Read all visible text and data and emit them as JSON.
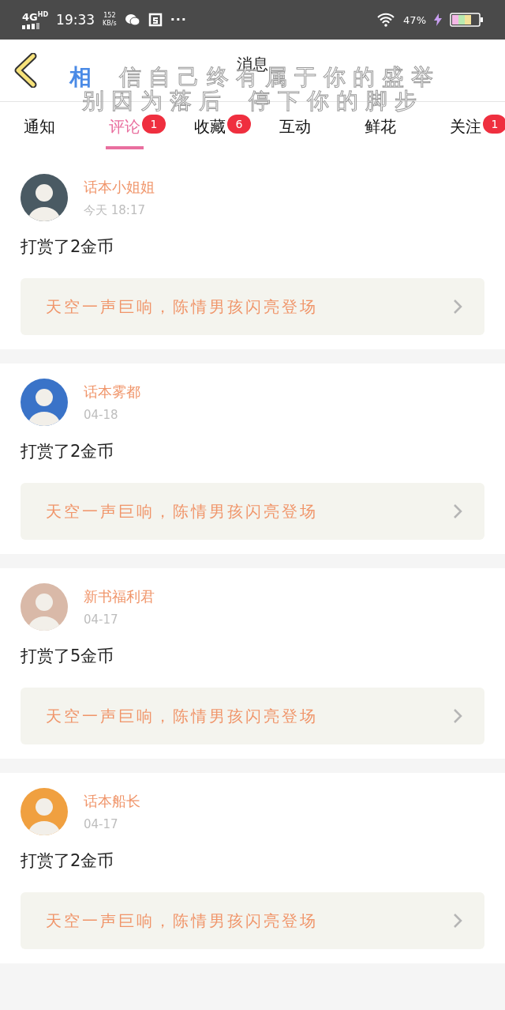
{
  "status_bar": {
    "network": "4G",
    "network_badge": "HD",
    "time": "19:33",
    "speed": "152",
    "speed_unit": "KB/s",
    "more": "···",
    "battery": "47%"
  },
  "header": {
    "title": "消息"
  },
  "tabs": [
    {
      "label": "通知",
      "selected": false
    },
    {
      "label": "评论",
      "selected": true,
      "badge": "1"
    },
    {
      "label": "收藏",
      "selected": false,
      "badge": "6"
    },
    {
      "label": "互动",
      "selected": false
    },
    {
      "label": "鲜花",
      "selected": false
    },
    {
      "label": "关注",
      "selected": false,
      "badge": "1"
    }
  ],
  "lyrics_overlay": {
    "lines": [
      [
        {
          "text": "相",
          "sung": true
        },
        {
          "text": "信自己终有属于你的盛举",
          "sung": false
        }
      ],
      [
        {
          "text": "别因为落后",
          "sung": false
        },
        {
          "text": "停下你的脚步",
          "sung": false
        }
      ]
    ]
  },
  "messages": [
    {
      "user": "话本小姐姐",
      "time": "今天 18:17",
      "action": "打赏了2金币",
      "book": "天空一声巨响，陈情男孩闪亮登场"
    },
    {
      "user": "话本雾都",
      "time": "04-18",
      "action": "打赏了2金币",
      "book": "天空一声巨响，陈情男孩闪亮登场"
    },
    {
      "user": "新书福利君",
      "time": "04-17",
      "action": "打赏了5金币",
      "book": "天空一声巨响，陈情男孩闪亮登场"
    },
    {
      "user": "话本船长",
      "time": "04-17",
      "action": "打赏了2金币",
      "book": "天空一声巨响，陈情男孩闪亮登场"
    }
  ]
}
